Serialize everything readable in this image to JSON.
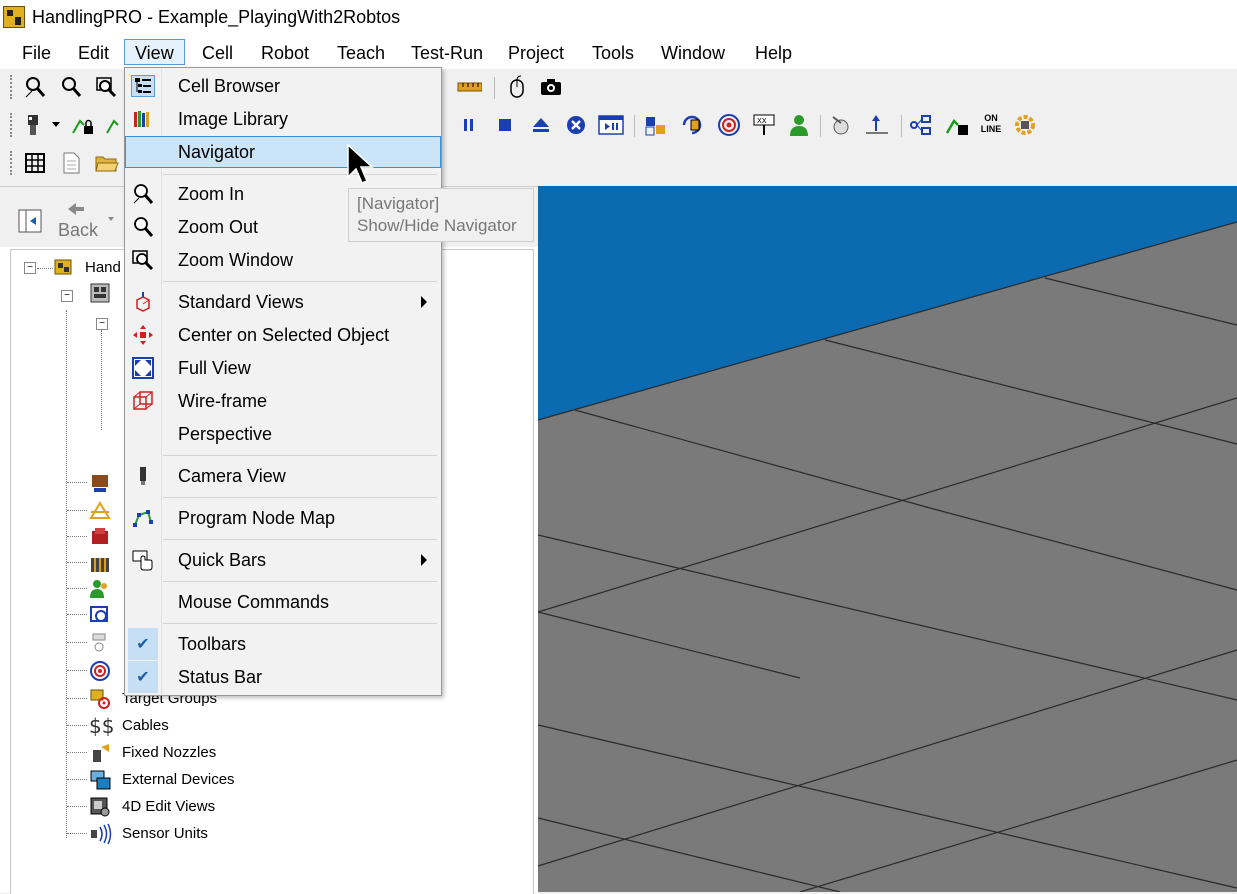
{
  "window": {
    "title": "HandlingPRO - Example_PlayingWith2Robtos",
    "icon": "handlingpro-logo-icon"
  },
  "menubar": {
    "items": [
      {
        "label": "File"
      },
      {
        "label": "Edit"
      },
      {
        "label": "View"
      },
      {
        "label": "Cell"
      },
      {
        "label": "Robot"
      },
      {
        "label": "Teach"
      },
      {
        "label": "Test-Run"
      },
      {
        "label": "Project"
      },
      {
        "label": "Tools"
      },
      {
        "label": "Window"
      },
      {
        "label": "Help"
      }
    ],
    "active": "View"
  },
  "toolbar": {
    "online_label_1": "ON",
    "online_label_2": "LINE"
  },
  "navigator_panel": {
    "back_label": "Back",
    "tree_root_label": "Hand",
    "tree_items": [
      {
        "label": "Target Groups",
        "icon": "target-groups-icon"
      },
      {
        "label": "Cables",
        "icon": "cables-icon"
      },
      {
        "label": "Fixed Nozzles",
        "icon": "fixed-nozzles-icon"
      },
      {
        "label": "External Devices",
        "icon": "external-devices-icon"
      },
      {
        "label": "4D Edit Views",
        "icon": "4d-edit-views-icon"
      },
      {
        "label": "Sensor Units",
        "icon": "sensor-units-icon"
      }
    ]
  },
  "view_menu": {
    "items": [
      {
        "label": "Cell Browser",
        "icon": "cell-browser-icon"
      },
      {
        "label": "Image Library",
        "icon": "image-library-icon"
      },
      {
        "label": "Navigator",
        "highlighted": true
      },
      {
        "label": "Zoom In",
        "icon": "zoom-in-icon"
      },
      {
        "label": "Zoom Out",
        "icon": "zoom-out-icon"
      },
      {
        "label": "Zoom Window",
        "icon": "zoom-window-icon"
      },
      {
        "label": "Standard Views",
        "submenu": true,
        "icon": "standard-views-icon"
      },
      {
        "label": "Center on Selected Object",
        "icon": "center-object-icon"
      },
      {
        "label": "Full View",
        "icon": "full-view-icon"
      },
      {
        "label": "Wire-frame",
        "icon": "wireframe-icon"
      },
      {
        "label": "Perspective"
      },
      {
        "label": "Camera View",
        "icon": "camera-view-icon"
      },
      {
        "label": "Program Node Map",
        "icon": "program-node-map-icon"
      },
      {
        "label": "Quick Bars",
        "submenu": true,
        "icon": "quick-bars-icon"
      },
      {
        "label": "Mouse Commands"
      },
      {
        "label": "Toolbars",
        "checked": true
      },
      {
        "label": "Status Bar",
        "checked": true
      }
    ]
  },
  "tooltip": {
    "title": "[Navigator]",
    "description": "Show/Hide Navigator"
  },
  "colors": {
    "sky": "#0b6ab0",
    "floor": "#7a7a7a",
    "menu_highlight": "#cce4f7",
    "menu_highlight_border": "#3e8fd6"
  }
}
